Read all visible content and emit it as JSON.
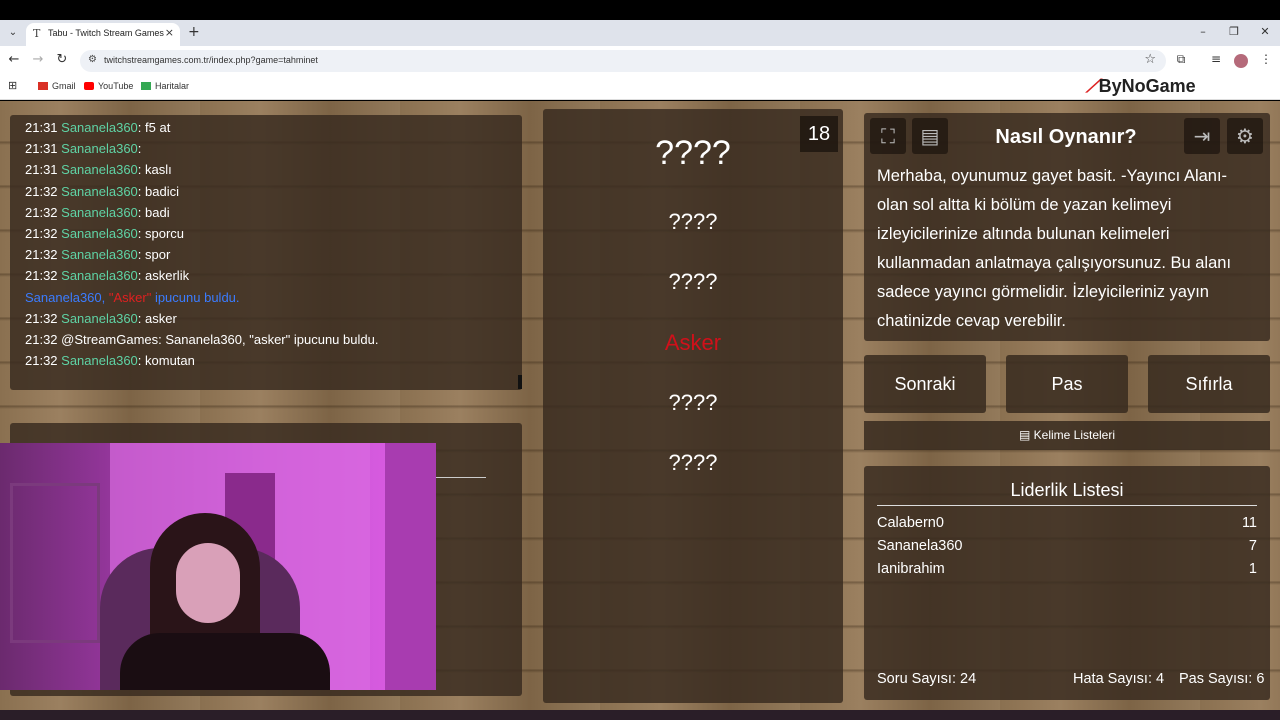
{
  "browser": {
    "tab_title": "Tabu - Twitch Stream Games",
    "url": "twitchstreamgames.com.tr/index.php?game=tahminet",
    "bookmarks": [
      "Gmail",
      "YouTube",
      "Haritalar"
    ],
    "brand_logo": "ByNoGame"
  },
  "chat": {
    "lines": [
      {
        "time": "21:31",
        "user": "Sananela360",
        "text": ": f5 at"
      },
      {
        "time": "21:31",
        "user": "Sananela360",
        "text": ":"
      },
      {
        "time": "21:31",
        "user": "Sananela360",
        "text": ": kaslı"
      },
      {
        "time": "21:32",
        "user": "Sananela360",
        "text": ": badici"
      },
      {
        "time": "21:32",
        "user": "Sananela360",
        "text": ": badi"
      },
      {
        "time": "21:32",
        "user": "Sananela360",
        "text": ": sporcu"
      },
      {
        "time": "21:32",
        "user": "Sananela360",
        "text": ": spor"
      },
      {
        "time": "21:32",
        "user": "Sananela360",
        "text": ": askerlik"
      }
    ],
    "notice": {
      "pre": "Sananela360, ",
      "word": "\"Asker\"",
      "post": " ipucunu buldu."
    },
    "lines2": [
      {
        "time": "21:32",
        "user": "Sananela360",
        "text": ": asker"
      },
      {
        "time": "21:32",
        "user": "",
        "text": "@StreamGames: Sananela360, \"asker\" ipucunu buldu."
      },
      {
        "time": "21:32",
        "user": "Sananela360",
        "text": ": komutan"
      }
    ]
  },
  "game": {
    "counter": "18",
    "main_word": "????",
    "words": [
      "????",
      "????",
      "Asker",
      "????",
      "????"
    ]
  },
  "help": {
    "title": "Nasıl Oynanır?",
    "text": "Merhaba, oyunumuz gayet basit. -Yayıncı Alanı- olan sol altta ki bölüm de yazan kelimeyi izleyicilerinize altında bulunan kelimeleri kullanmadan anlatmaya çalışıyorsunuz. Bu alanı sadece yayıncı görmelidir. İzleyicileriniz yayın chatinizde cevap verebilir."
  },
  "buttons": {
    "next": "Sonraki",
    "pass": "Pas",
    "reset": "Sıfırla",
    "word_lists": "Kelime Listeleri"
  },
  "leaderboard": {
    "title": "Liderlik Listesi",
    "rows": [
      {
        "name": "Calabern0",
        "score": "11"
      },
      {
        "name": "Sananela360",
        "score": "7"
      },
      {
        "name": "Ianibrahim",
        "score": "1"
      }
    ]
  },
  "stats": {
    "questions": "Soru Sayısı: 24",
    "errors": "Hata Sayısı: 4",
    "passes": "Pas Sayısı: 6"
  },
  "colors": {
    "chat_user": "#5fd3a5",
    "notice": "#3b7cff",
    "found_word": "#d0101a"
  }
}
